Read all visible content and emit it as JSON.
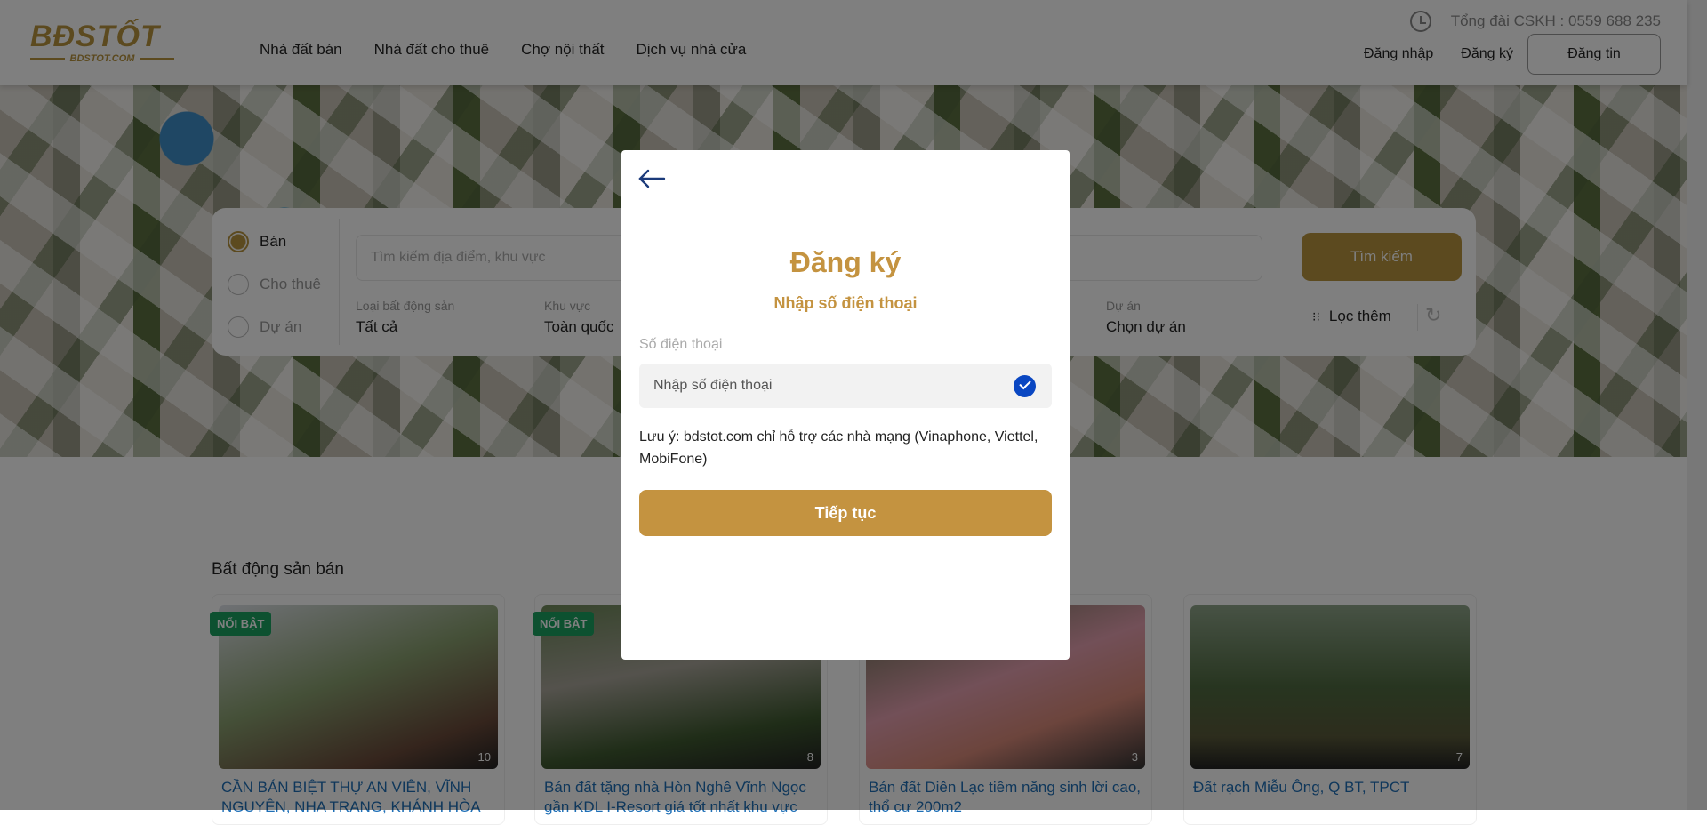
{
  "header": {
    "logo": "BĐSTỐT",
    "logo_sub": "BDSTOT.COM",
    "nav": [
      "Nhà đất bán",
      "Nhà đất cho thuê",
      "Chợ nội thất",
      "Dịch vụ nhà cửa"
    ],
    "hotline": "Tổng đài CSKH : 0559 688 235",
    "login": "Đăng nhập",
    "register": "Đăng ký",
    "post": "Đăng tin"
  },
  "search": {
    "modes": [
      {
        "label": "Bán",
        "selected": true
      },
      {
        "label": "Cho thuê",
        "selected": false
      },
      {
        "label": "Dự án",
        "selected": false
      }
    ],
    "placeholder": "Tìm kiếm địa điểm, khu vực",
    "button": "Tìm kiếm",
    "filters": [
      {
        "label": "Loại bất động sản",
        "value": "Tất cả"
      },
      {
        "label": "Khu vực",
        "value": "Toàn quốc"
      },
      {
        "label": "Dự án",
        "value": "Chọn dự án"
      }
    ],
    "more": "Lọc thêm"
  },
  "section": {
    "title": "Bất động sản bán",
    "cards": [
      {
        "badge": "NỔI BẬT",
        "count": "10",
        "title": "CẦN BÁN BIỆT THỰ AN VIÊN, VĨNH NGUYÊN, NHA TRANG, KHÁNH HÒA"
      },
      {
        "badge": "NỔI BẬT",
        "count": "8",
        "title": "Bán đất tặng nhà Hòn Nghê Vĩnh Ngọc gần KDL I-Resort giá tốt nhất khu vực"
      },
      {
        "badge": "",
        "count": "3",
        "title": "Bán đất Diên Lạc tiềm năng sinh lời cao, thổ cư 200m2"
      },
      {
        "badge": "",
        "count": "7",
        "title": "Đất rạch Miễu Ông, Q BT, TPCT"
      }
    ]
  },
  "modal": {
    "title": "Đăng ký",
    "subtitle": "Nhập số điện thoại",
    "field_label": "Số điện thoại",
    "placeholder": "Nhập số điện thoại",
    "note": "Lưu ý: bdstot.com chỉ hỗ trợ các nhà mạng (Vinaphone, Viettel, MobiFone)",
    "submit": "Tiếp tục"
  },
  "colors": {
    "brand": "#c49340",
    "featured": "#1aa260",
    "link": "#1f6fb6",
    "check": "#0a47c2"
  }
}
